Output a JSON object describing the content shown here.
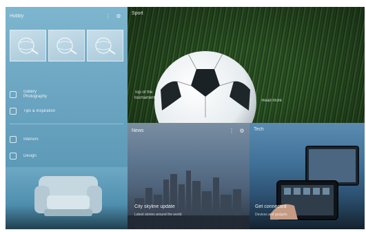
{
  "left_panel": {
    "title": "Hobby",
    "menu": [
      {
        "label": "Gallery\nPhotography",
        "icon": "image-icon"
      },
      {
        "label": "Tips & Inspiration",
        "icon": "lightbulb-icon"
      },
      {
        "label": "Interiors",
        "icon": "folder-icon"
      },
      {
        "label": "Design",
        "icon": "folder-icon"
      }
    ]
  },
  "sports": {
    "title": "Sport",
    "caption": "Top of the\ntournament",
    "more": "Read more"
  },
  "news": {
    "title": "News",
    "headline": "City skyline update",
    "sub": "Latest stories around the world"
  },
  "tech": {
    "title": "Tech",
    "headline": "Get connected",
    "sub": "Devices and gadgets"
  },
  "colors": {
    "left_panel_bg": "#6aa4c0",
    "grass": "#2c5225"
  }
}
